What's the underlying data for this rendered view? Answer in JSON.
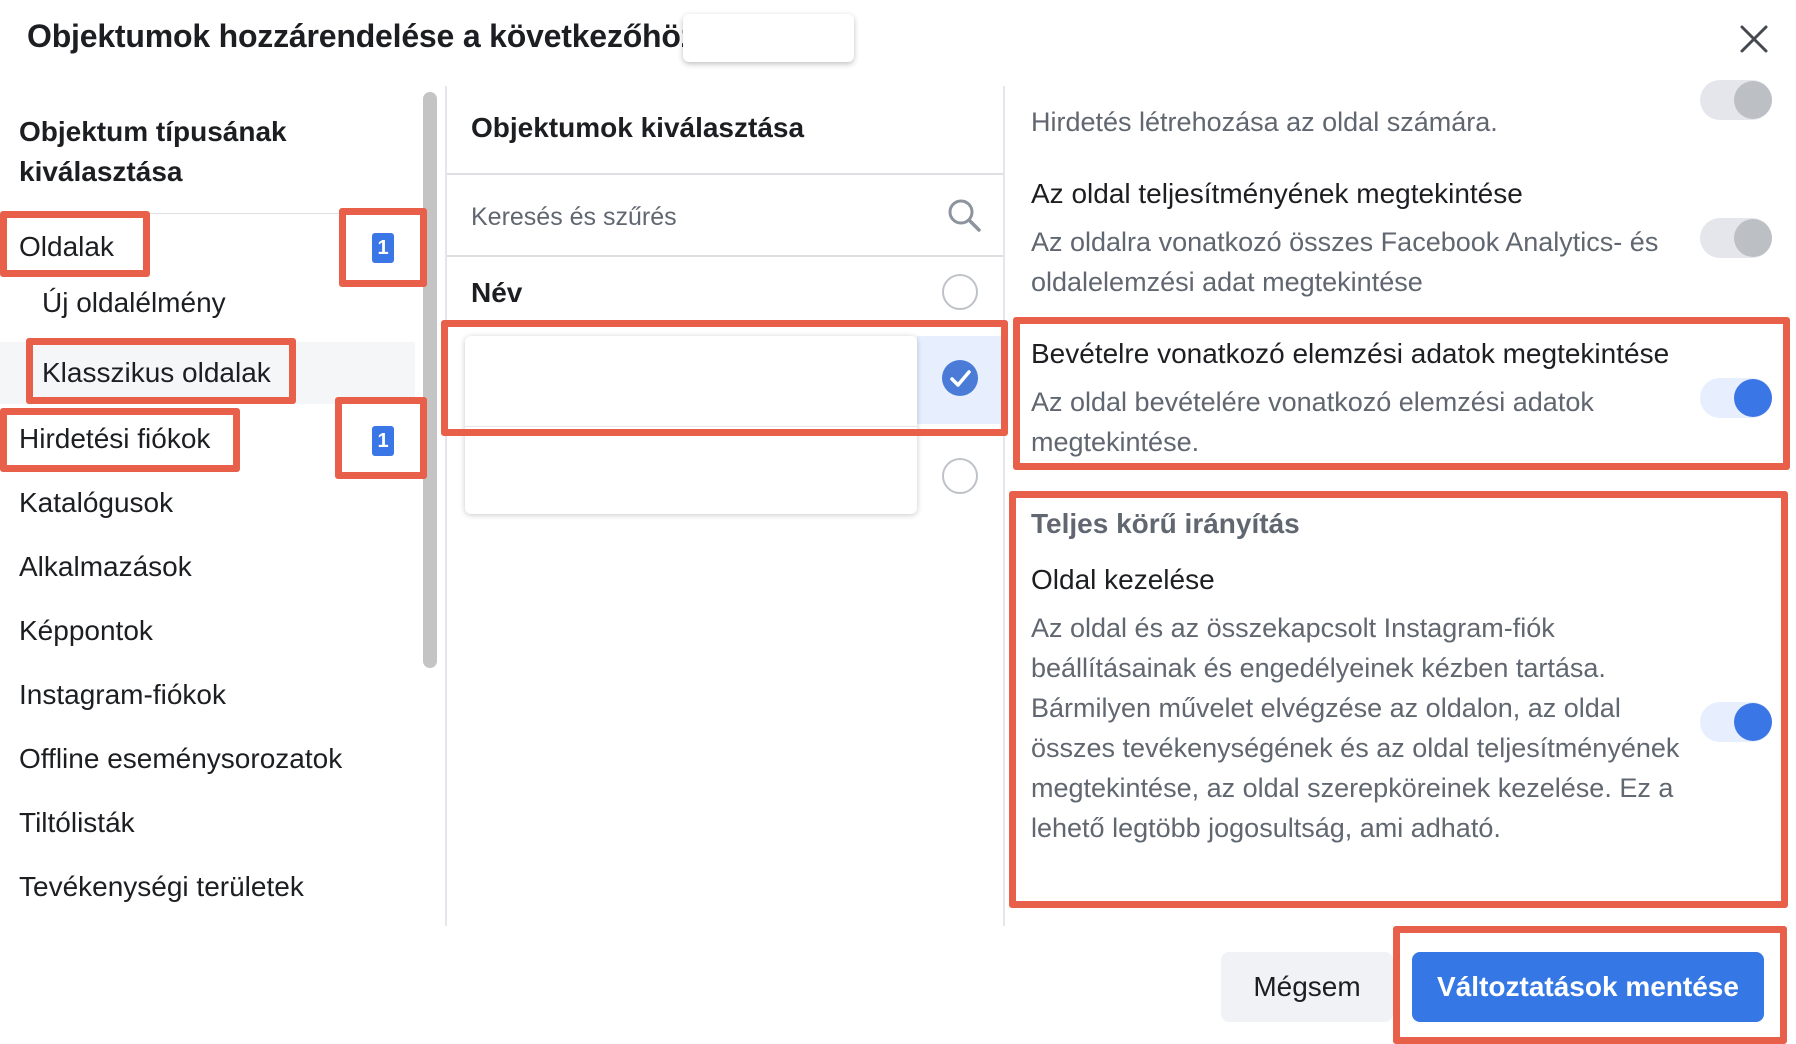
{
  "dialog": {
    "title": "Objektumok hozzárendelése a következőhöz:",
    "close_icon": "close-icon"
  },
  "left": {
    "heading": "Objektum típusának kiválasztása",
    "items": [
      {
        "label": "Oldalak",
        "badge": "1"
      },
      {
        "label": "Új oldalélmény"
      },
      {
        "label": "Klasszikus oldalak"
      },
      {
        "label": "Hirdetési fiókok",
        "badge": "1"
      },
      {
        "label": "Katalógusok"
      },
      {
        "label": "Alkalmazások"
      },
      {
        "label": "Képpontok"
      },
      {
        "label": "Instagram-fiókok"
      },
      {
        "label": "Offline eseménysorozatok"
      },
      {
        "label": "Tiltólisták"
      },
      {
        "label": "Tevékenységi területek"
      }
    ]
  },
  "middle": {
    "heading": "Objektumok kiválasztása",
    "search_placeholder": "Keresés és szűrés",
    "search_icon": "search-icon",
    "column_label": "Név"
  },
  "right": {
    "perm0_desc": "Hirdetés létrehozása az oldal számára.",
    "perm1_title": "Az oldal teljesítményének megtekintése",
    "perm1_desc": "Az oldalra vonatkozó összes Facebook Analytics- és oldalelemzési adat megtekintése",
    "perm2_title": "Bevételre vonatkozó elemzési adatok megtekintése",
    "perm2_desc": "Az oldal bevételére vonatkozó elemzési adatok megtekintése.",
    "section_title": "Teljes körű irányítás",
    "perm3_title": "Oldal kezelése",
    "perm3_desc": "Az oldal és az összekapcsolt Instagram-fiók beállításainak és engedélyeinek kézben tartása. Bármilyen művelet elvégzése az oldalon, az oldal összes tevékenységének és az oldal teljesítményének megtekintése, az oldal szerepköreinek kezelése. Ez a lehető legtöbb jogosultság, ami adható."
  },
  "footer": {
    "cancel_label": "Mégsem",
    "save_label": "Változtatások mentése"
  },
  "colors": {
    "accent": "#3578e5",
    "annotation": "#e8604a",
    "toggle_on": "#3b76e6",
    "toggle_off": "#bcc0c4"
  }
}
